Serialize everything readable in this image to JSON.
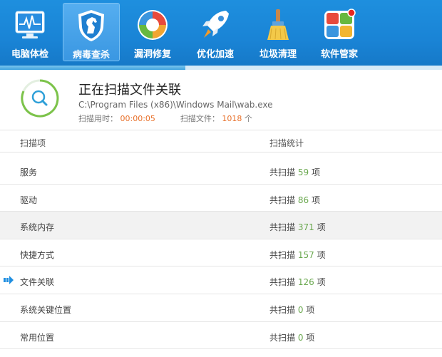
{
  "toolbar": {
    "items": [
      {
        "label": "电脑体检",
        "icon": "monitor-heartbeat-icon"
      },
      {
        "label": "病毒查杀",
        "icon": "horse-shield-icon"
      },
      {
        "label": "漏洞修复",
        "icon": "repair-ring-icon"
      },
      {
        "label": "优化加速",
        "icon": "rocket-icon"
      },
      {
        "label": "垃圾清理",
        "icon": "broom-icon"
      },
      {
        "label": "软件管家",
        "icon": "software-tiles-icon"
      }
    ],
    "active_index": 1,
    "scan_progress": 0.42
  },
  "status": {
    "title": "正在扫描文件关联",
    "path": "C:\\Program Files (x86)\\Windows Mail\\wab.exe",
    "elapsed_label": "扫描用时：",
    "elapsed_value": "00:00:05",
    "files_label": "扫描文件：",
    "files_value": "1018",
    "files_unit": "个"
  },
  "table": {
    "headers": {
      "item": "扫描项",
      "stats": "扫描统计"
    },
    "stat_prefix": "共扫描",
    "stat_suffix": "项",
    "rows": [
      {
        "name": "服务",
        "count": "59"
      },
      {
        "name": "驱动",
        "count": "86"
      },
      {
        "name": "系统内存",
        "count": "371"
      },
      {
        "name": "快捷方式",
        "count": "157"
      },
      {
        "name": "文件关联",
        "count": "126"
      },
      {
        "name": "系统关键位置",
        "count": "0"
      },
      {
        "name": "常用位置",
        "count": "0"
      }
    ],
    "highlight_row_index": 2,
    "current_row_index": 4
  },
  "colors": {
    "toolbar_blue": "#1a84d6",
    "accent_orange": "#e8702a",
    "count_green": "#6aa84f",
    "spinner_green": "#7cc34a"
  }
}
